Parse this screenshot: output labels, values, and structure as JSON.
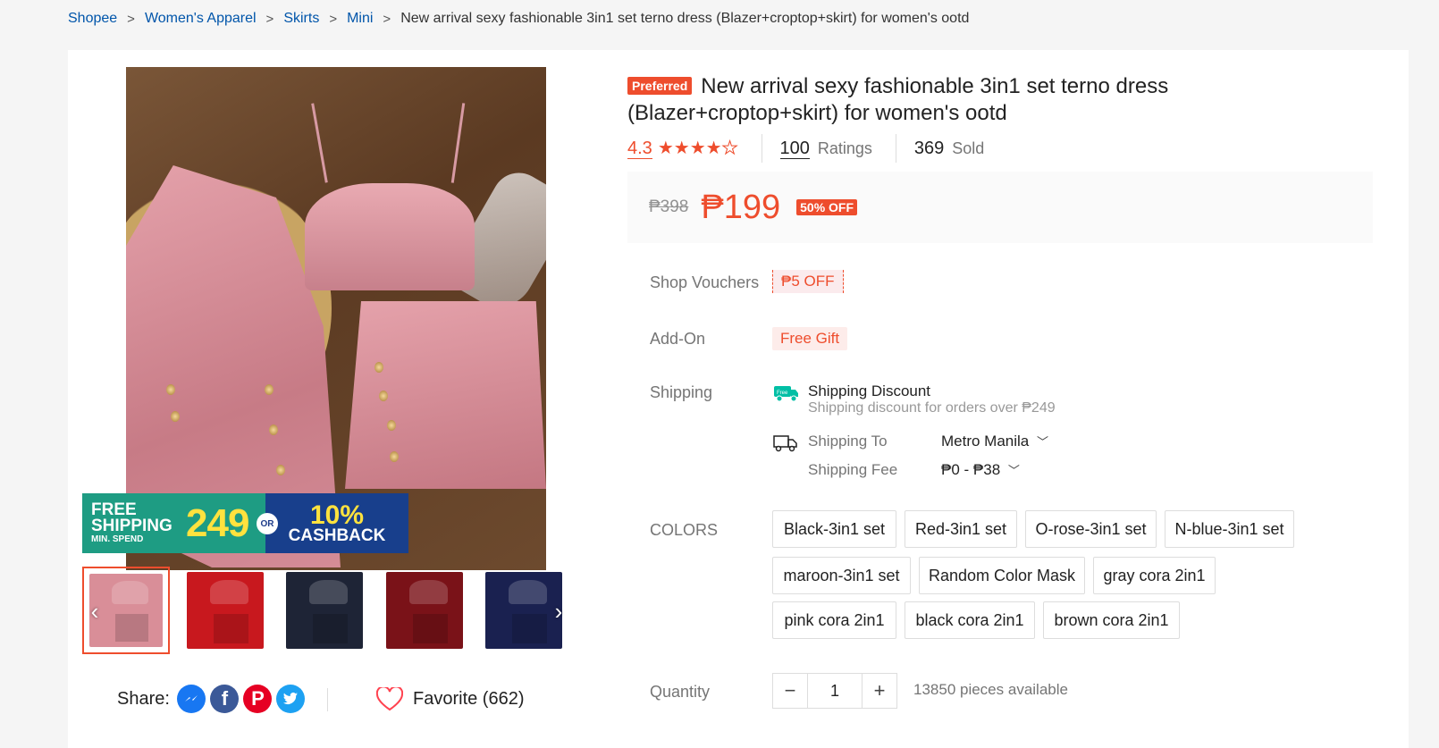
{
  "breadcrumb": {
    "items": [
      "Shopee",
      "Women's Apparel",
      "Skirts",
      "Mini"
    ],
    "current": "New arrival sexy fashionable 3in1 set terno dress (Blazer+croptop+skirt) for women's ootd",
    "separator": ">"
  },
  "gallery": {
    "promo": {
      "free_shipping": "FREE SHIPPING",
      "min_spend": "MIN. SPEND",
      "amount": "249",
      "or": "OR",
      "cashback_pct": "10%",
      "cashback": "CASHBACK"
    },
    "thumbnails": [
      {
        "color": "#d98e98"
      },
      {
        "color": "#c8181e"
      },
      {
        "color": "#1e2436"
      },
      {
        "color": "#7a1218"
      },
      {
        "color": "#1a2150"
      }
    ],
    "prev_icon": "chevron-left-icon",
    "next_icon": "chevron-right-icon"
  },
  "share": {
    "label": "Share:",
    "icons": [
      "messenger-icon",
      "facebook-icon",
      "pinterest-icon",
      "twitter-icon"
    ]
  },
  "favorite": {
    "label": "Favorite (662)"
  },
  "product": {
    "badge": "Preferred",
    "title": "New arrival sexy fashionable 3in1 set terno dress (Blazer+croptop+skirt) for women's ootd",
    "rating": "4.3",
    "stars_filled": 4,
    "stars_total": 5,
    "ratings_count": "100",
    "ratings_label": "Ratings",
    "sold_count": "369",
    "sold_label": "Sold"
  },
  "price": {
    "original": "₱398",
    "current": "₱199",
    "discount": "50% OFF"
  },
  "vouchers": {
    "label": "Shop Vouchers",
    "value": "₱5 OFF"
  },
  "addon": {
    "label": "Add-On",
    "value": "Free Gift"
  },
  "shipping": {
    "label": "Shipping",
    "discount_title": "Shipping Discount",
    "discount_desc": "Shipping discount for orders over ₱249",
    "to_label": "Shipping To",
    "to_value": "Metro Manila",
    "fee_label": "Shipping Fee",
    "fee_value": "₱0 - ₱38"
  },
  "colors": {
    "label": "COLORS",
    "options": [
      "Black-3in1 set",
      "Red-3in1 set",
      "O-rose-3in1 set",
      "N-blue-3in1 set",
      "maroon-3in1 set",
      "Random Color Mask",
      "gray cora 2in1",
      "pink cora 2in1",
      "black cora 2in1",
      "brown cora 2in1"
    ]
  },
  "quantity": {
    "label": "Quantity",
    "value": "1",
    "minus": "−",
    "plus": "+",
    "available": "13850 pieces available"
  },
  "theme": {
    "accent": "#ee4d2d",
    "link": "#0055aa"
  }
}
